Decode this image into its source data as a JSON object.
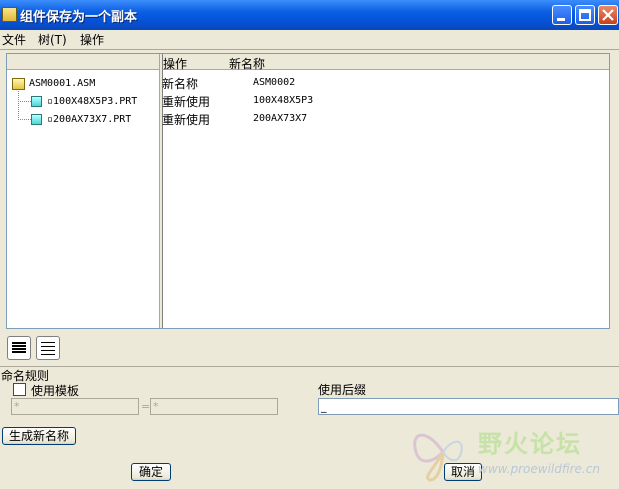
{
  "window": {
    "title": "组件保存为一个副本"
  },
  "menu": {
    "file": "文件",
    "tree": "树(T)",
    "operation": "操作"
  },
  "table": {
    "col_operation": "操作",
    "col_new_name": "新名称",
    "rows": [
      {
        "operation": "新名称",
        "new_name": "ASM0002"
      },
      {
        "operation": "重新使用",
        "new_name": "100X48X5P3"
      },
      {
        "operation": "重新使用",
        "new_name": "200AX73X7"
      }
    ]
  },
  "tree": {
    "root": "ASM0001.ASM",
    "children": [
      "100X48X5P3.PRT",
      "200AX73X7.PRT"
    ]
  },
  "naming": {
    "section_label": "命名规则",
    "use_template_label": "使用模板",
    "field_left": "*",
    "equals": "=",
    "field_right": "*",
    "use_suffix_label": "使用后缀",
    "suffix_value": "_"
  },
  "buttons": {
    "generate": "生成新名称",
    "ok": "确定",
    "cancel": "取消"
  },
  "watermark": {
    "text": "野火论坛",
    "url": "www.proewildfire.cn"
  }
}
